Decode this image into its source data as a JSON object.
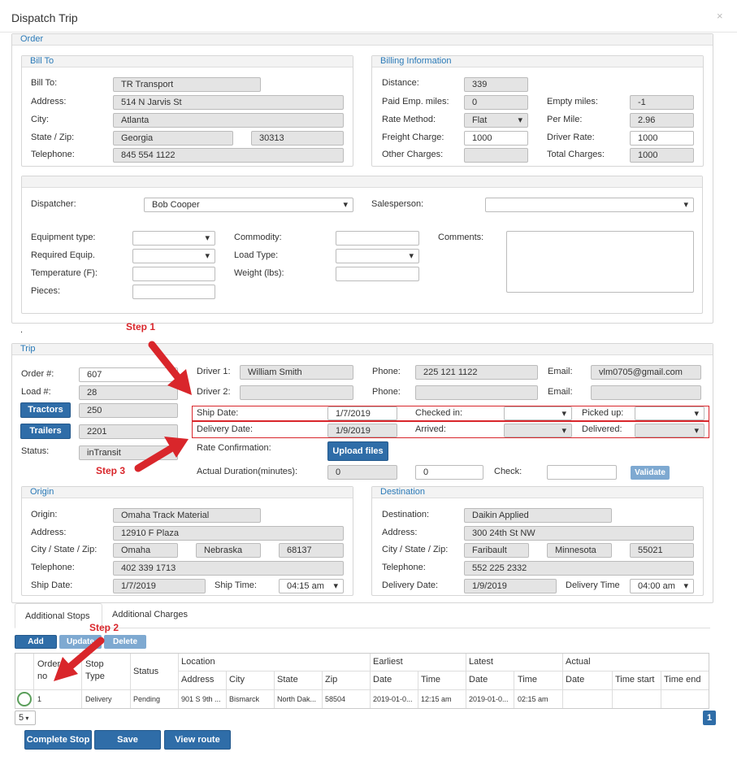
{
  "dialog": {
    "title": "Dispatch Trip",
    "close": "×"
  },
  "order": {
    "legend": "Order",
    "bill_to": {
      "legend": "Bill To",
      "bill_to_label": "Bill To:",
      "bill_to": "TR Transport",
      "address_label": "Address:",
      "address": "514 N Jarvis St",
      "city_label": "City:",
      "city": "Atlanta",
      "state_zip_label": "State / Zip:",
      "state": "Georgia",
      "zip": "30313",
      "telephone_label": "Telephone:",
      "telephone": "845 554 1122"
    },
    "billing": {
      "legend": "Billing Information",
      "distance_label": "Distance:",
      "distance": "339",
      "paid_label": "Paid Emp. miles:",
      "paid": "0",
      "empty_label": "Empty miles:",
      "empty": "-1",
      "rate_method_label": "Rate Method:",
      "rate_method": "Flat",
      "per_mile_label": "Per Mile:",
      "per_mile": "2.96",
      "freight_label": "Freight Charge:",
      "freight": "1000",
      "driver_rate_label": "Driver Rate:",
      "driver_rate": "1000",
      "other_label": "Other Charges:",
      "other": "",
      "total_label": "Total Charges:",
      "total": "1000"
    },
    "dispatcher_label": "Dispatcher:",
    "dispatcher": "Bob Cooper",
    "salesperson_label": "Salesperson:",
    "salesperson": "",
    "equipment_label": "Equipment type:",
    "required_label": "Required Equip.",
    "temperature_label": "Temperature (F):",
    "pieces_label": "Pieces:",
    "commodity_label": "Commodity:",
    "load_type_label": "Load Type:",
    "weight_label": "Weight (lbs):",
    "comments_label": "Comments:"
  },
  "dot": ".",
  "trip": {
    "legend": "Trip",
    "order_no_label": "Order #:",
    "order_no": "607",
    "load_no_label": "Load #:",
    "load_no": "28",
    "tractors_label": "Tractors",
    "tractors": "250",
    "trailers_label": "Trailers",
    "trailers": "2201",
    "status_label": "Status:",
    "status": "inTransit",
    "driver1_label": "Driver 1:",
    "driver1": "William Smith",
    "driver2_label": "Driver 2:",
    "driver2": "",
    "phone1_label": "Phone:",
    "phone1": "225 121 1122",
    "phone2_label": "Phone:",
    "phone2": "",
    "email1_label": "Email:",
    "email1": "vlm0705@gmail.com",
    "email2_label": "Email:",
    "email2": "",
    "ship_date_label": "Ship Date:",
    "ship_date": "1/7/2019",
    "checked_in_label": "Checked in:",
    "picked_up_label": "Picked up:",
    "delivery_date_label": "Delivery Date:",
    "delivery_date": "1/9/2019",
    "arrived_label": "Arrived:",
    "delivered_label": "Delivered:",
    "rate_conf_label": "Rate Confirmation:",
    "upload_label": "Upload files",
    "duration_label": "Actual Duration(minutes):",
    "duration1": "0",
    "duration2": "0",
    "check_label": "Check:",
    "validate_label": "Validate"
  },
  "origin": {
    "legend": "Origin",
    "origin_label": "Origin:",
    "origin": "Omaha Track Material",
    "address_label": "Address:",
    "address": "12910 F Plaza",
    "csz_label": "City / State / Zip:",
    "city": "Omaha",
    "state": "Nebraska",
    "zip": "68137",
    "telephone_label": "Telephone:",
    "telephone": "402 339 1713",
    "ship_date_label": "Ship Date:",
    "ship_date": "1/7/2019",
    "ship_time_label": "Ship Time:",
    "ship_time": "04:15 am"
  },
  "destination": {
    "legend": "Destination",
    "destination_label": "Destination:",
    "destination": "Daikin Applied",
    "address_label": "Address:",
    "address": "300 24th St NW",
    "csz_label": "City / State / Zip:",
    "city": "Faribault",
    "state": "Minnesota",
    "zip": "55021",
    "telephone_label": "Telephone:",
    "telephone": "552 225 2332",
    "delivery_date_label": "Delivery Date:",
    "delivery_date": "1/9/2019",
    "delivery_time_label": "Delivery Time",
    "delivery_time": "04:00 am"
  },
  "tabs": {
    "stops": "Additional Stops",
    "charges": "Additional Charges"
  },
  "grid_buttons": {
    "add": "Add",
    "update": "Update",
    "delete": "Delete"
  },
  "grid": {
    "group_location": "Location",
    "group_earliest": "Earliest",
    "group_latest": "Latest",
    "group_actual": "Actual",
    "col_order_line1": "Order",
    "col_order_line2": "no",
    "col_stop_line1": "Stop",
    "col_stop_line2": "Type",
    "col_status": "Status",
    "col_address": "Address",
    "col_city": "City",
    "col_state": "State",
    "col_zip": "Zip",
    "col_e_date": "Date",
    "col_e_time": "Time",
    "col_l_date": "Date",
    "col_l_time": "Time",
    "col_a_date": "Date",
    "col_time_start": "Time start",
    "col_time_end": "Time end",
    "row": {
      "order_no": "1",
      "stop_type": "Delivery",
      "status": "Pending",
      "address": "901 S 9th ...",
      "city": "Bismarck",
      "state": "North Dak...",
      "zip": "58504",
      "e_date": "2019-01-0...",
      "e_time": "12:15 am",
      "l_date": "2019-01-0...",
      "l_time": "02:15 am"
    },
    "page_size": "5",
    "page": "1"
  },
  "footer": {
    "complete_stop": "Complete Stop",
    "save": "Save",
    "view_route": "View route"
  },
  "annotations": {
    "step1": "Step 1",
    "step2": "Step 2",
    "step3": "Step 3"
  },
  "colors": {
    "primary": "#2f6da8",
    "annotation": "#d9262b",
    "legend_text": "#2a7ab8"
  }
}
